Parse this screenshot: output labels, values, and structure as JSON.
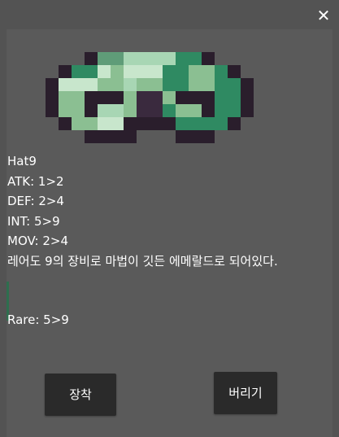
{
  "window": {
    "close_label": "✕"
  },
  "item": {
    "icon": "emerald-ring-icon",
    "name": "Hat9",
    "atk": "ATK: 1>2",
    "def": "DEF: 2>4",
    "int": "INT: 5>9",
    "mov": "MOV: 2>4",
    "description": "레어도 9의 장비로 마법이 깃든 에메랄드로 되어있다.",
    "rare": "Rare: 5>9"
  },
  "buttons": {
    "equip_label": "장착",
    "discard_label": "버리기"
  },
  "colors": {
    "background": "#535353",
    "button": "#2a2a2a",
    "text": "#ffffff",
    "emerald_dark": "#2f8a62",
    "emerald_light": "#a8d6b4",
    "outline": "#2a1e2c"
  }
}
